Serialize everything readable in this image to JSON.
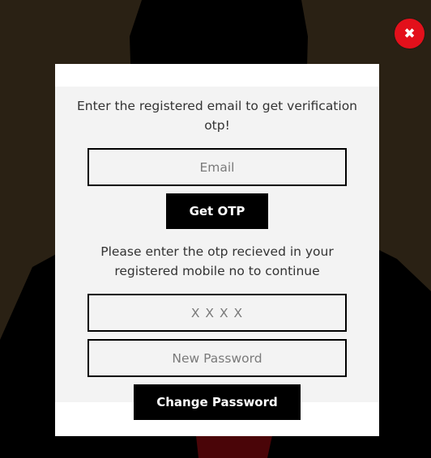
{
  "overlay": {
    "close_glyph": "✖"
  },
  "modal": {
    "email_prompt": "Enter the registered email to get verification otp!",
    "email_placeholder": "Email",
    "get_otp_label": "Get OTP",
    "otp_prompt": "Please enter the otp recieved in your registered mobile no to continue",
    "otp_placeholder": "X X X X",
    "new_password_placeholder": "New Password",
    "change_password_label": "Change Password"
  },
  "colors": {
    "backdrop": "#2a2114",
    "close_button": "#e3101b",
    "modal_panel": "#f3f3f3",
    "button": "#000000",
    "button_text": "#ffffff"
  }
}
